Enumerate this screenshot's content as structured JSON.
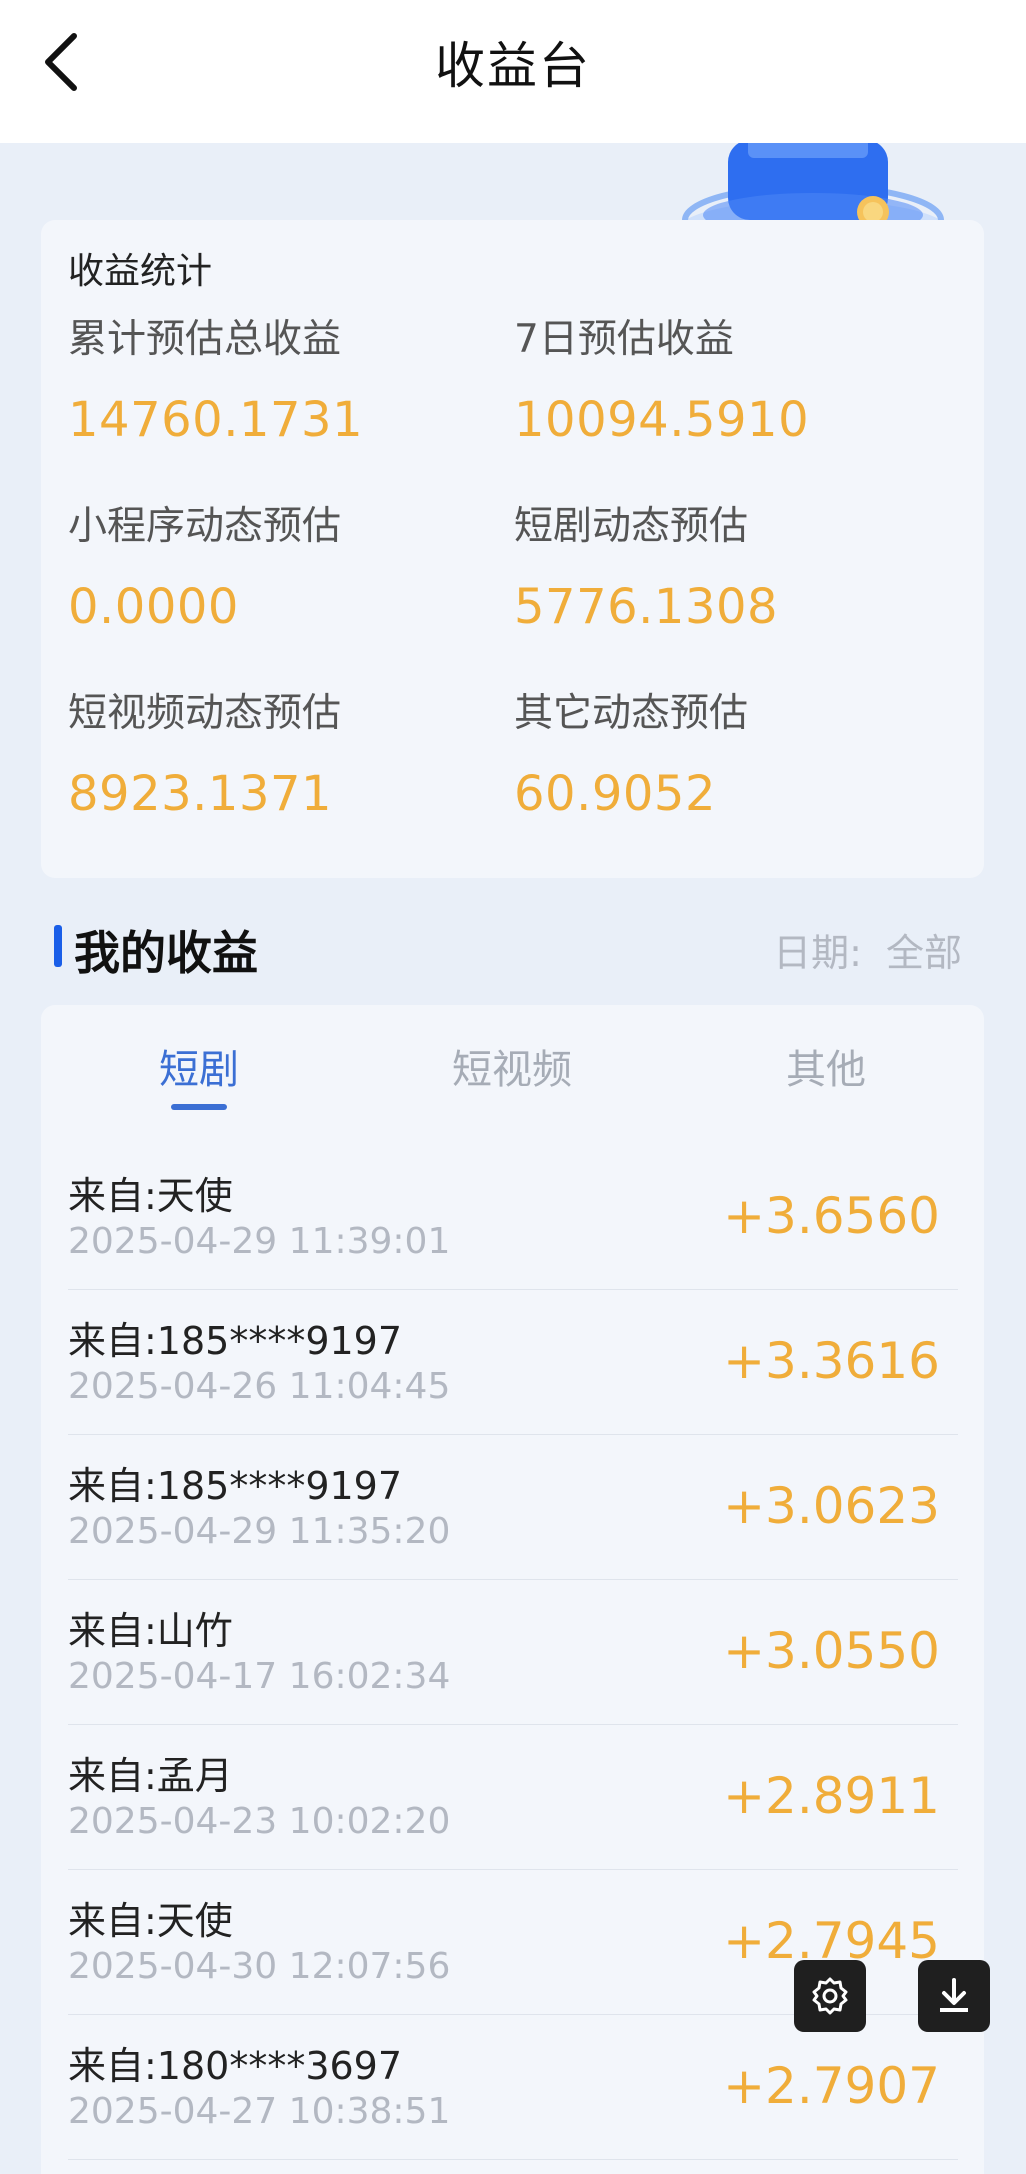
{
  "header": {
    "title": "收益台",
    "back_icon": "chevron-left-icon"
  },
  "stats": {
    "heading": "收益统计",
    "items": [
      {
        "label": "累计预估总收益",
        "value": "14760.1731"
      },
      {
        "label": "7日预估收益",
        "value": "10094.5910"
      },
      {
        "label": "小程序动态预估",
        "value": "0.0000"
      },
      {
        "label": "短剧动态预估",
        "value": "5776.1308"
      },
      {
        "label": "短视频动态预估",
        "value": "8923.1371"
      },
      {
        "label": "其它动态预估",
        "value": "60.9052"
      }
    ]
  },
  "earnings": {
    "title": "我的收益",
    "date_label": "日期:",
    "date_value": "全部",
    "tabs": [
      {
        "label": "短剧",
        "active": true
      },
      {
        "label": "短视频",
        "active": false
      },
      {
        "label": "其他",
        "active": false
      }
    ],
    "rows": [
      {
        "from": "来自:天使",
        "time": "2025-04-29 11:39:01",
        "amount": "+3.6560"
      },
      {
        "from": "来自:185****9197",
        "time": "2025-04-26 11:04:45",
        "amount": "+3.3616"
      },
      {
        "from": "来自:185****9197",
        "time": "2025-04-29 11:35:20",
        "amount": "+3.0623"
      },
      {
        "from": "来自:山竹",
        "time": "2025-04-17 16:02:34",
        "amount": "+3.0550"
      },
      {
        "from": "来自:孟月",
        "time": "2025-04-23 10:02:20",
        "amount": "+2.8911"
      },
      {
        "from": "来自:天使",
        "time": "2025-04-30 12:07:56",
        "amount": "+2.7945"
      },
      {
        "from": "来自:180****3697",
        "time": "2025-04-27 10:38:51",
        "amount": "+2.7907"
      }
    ]
  },
  "colors": {
    "accent": "#3b6fd4",
    "amount": "#f0ad3a",
    "section_bar": "#1a5ee8"
  },
  "floating_buttons": {
    "settings_icon": "gear-icon",
    "download_icon": "download-icon"
  }
}
